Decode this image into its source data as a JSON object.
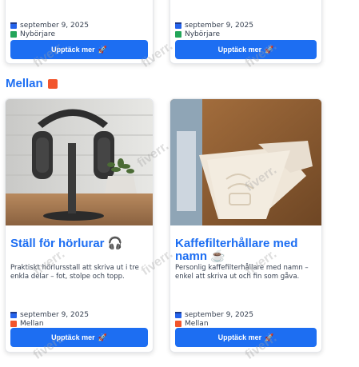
{
  "top_cards": [
    {
      "date": "september 9, 2025",
      "level": "Nybörjare",
      "button": "Upptäck mer"
    },
    {
      "date": "september 9, 2025",
      "level": "Nybörjare",
      "button": "Upptäck mer"
    }
  ],
  "section": {
    "title": "Mellan"
  },
  "cards": [
    {
      "title": "Ställ för hörlurar 🎧",
      "description": "Praktiskt hörlursstall att skriva ut i tre enkla delar – fot, stolpe och topp.",
      "date": "september 9, 2025",
      "level": "Mellan",
      "button": "Upptäck mer"
    },
    {
      "title": "Kaffefilterhållare med namn ☕",
      "description": "Personlig kaffefilterhållare med namn – enkel att skriva ut och fin som gåva.",
      "date": "september 9, 2025",
      "level": "Mellan",
      "button": "Upptäck mer"
    }
  ],
  "watermark": "fiverr.",
  "colors": {
    "accent": "#1d6ef2",
    "beginner": "#22a559",
    "intermediate": "#f2552c"
  }
}
